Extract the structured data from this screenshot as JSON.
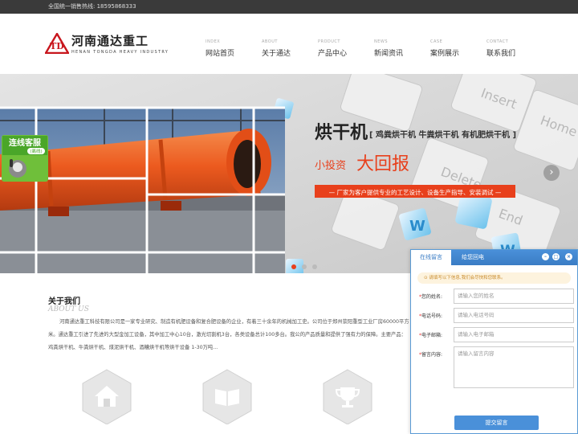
{
  "topbar": {
    "hotline": "全国统一销售热线: 18595868333"
  },
  "logo": {
    "cn": "河南通达重工",
    "en": "HENAN TONGDA HEAVY INDUSTRY"
  },
  "nav": [
    {
      "en": "INDEX",
      "cn": "网站首页"
    },
    {
      "en": "ABOUT",
      "cn": "关于通达"
    },
    {
      "en": "PRODUCT",
      "cn": "产品中心"
    },
    {
      "en": "NEWS",
      "cn": "新闻资讯"
    },
    {
      "en": "CASE",
      "cn": "案例展示"
    },
    {
      "en": "CONTACT",
      "cn": "联系我们"
    }
  ],
  "chat_badge": {
    "line1": "连线客服",
    "line2": "(离线)"
  },
  "banner": {
    "title": "烘干机",
    "subtitle": "[ 鸡粪烘干机 牛粪烘干机  有机肥烘干机 ]",
    "slogan_small": "小投资",
    "slogan_big": "大回报",
    "ribbon": "— 厂家为客户提供专业的工艺设计、设备生产指导、安装调试 —",
    "prev_arrow": "‹",
    "next_arrow": "›",
    "keys": [
      "Insert",
      "Home",
      "Delete",
      "End",
      "W",
      "W",
      "W"
    ]
  },
  "about": {
    "title": "关于我们",
    "title_en": "ABOUT US",
    "text": "河南通达重工科技有限公司是一家专业研究、制造有机肥设备和复合肥设备的企业，有着三十余年的机械加工史。公司位于郑州荥阳重型工业厂房60000平方米。通达重工引进了先进的大型金加工设备，其中加工中心10台，激光切割机3台，各类设备总计100多台。我公的产品质量和提供了强有力的保障。主要产品： 鸡粪烘干机、牛粪烘干机、煤泥烘干机、酒糟烘干机等烘干设备 1-30万吨..."
  },
  "hex_icons": [
    "home-icon",
    "book-icon",
    "trophy-icon"
  ],
  "message_panel": {
    "tab_active": "在线留言",
    "tab_inactive": "给您回电",
    "controls": [
      "–",
      "□",
      "×"
    ],
    "notice": "请填写以下信息,我们会尽快和您联系。",
    "fields": [
      {
        "label": "您的姓名:",
        "placeholder": "请输入您的姓名"
      },
      {
        "label": "电话号码:",
        "placeholder": "请输入电话号码"
      },
      {
        "label": "电子邮箱:",
        "placeholder": "请输入电子邮箱"
      },
      {
        "label": "留言内容:",
        "placeholder": "请输入留言内容"
      }
    ],
    "submit": "提交留言"
  },
  "colors": {
    "accent": "#e8401c",
    "panel_blue": "#4a90d9",
    "topbar": "#3a3a3a"
  }
}
